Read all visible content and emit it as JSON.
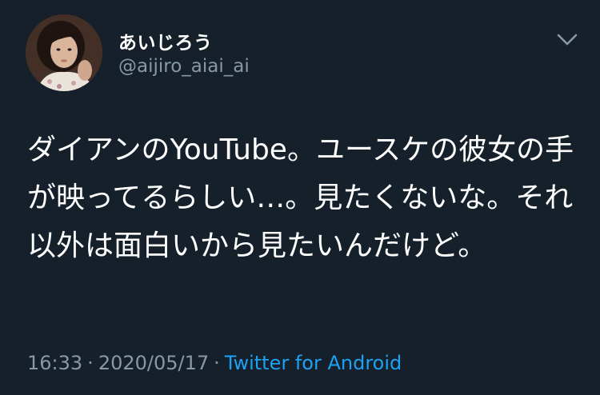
{
  "user": {
    "display_name": "あいじろう",
    "handle": "@aijiro_aiai_ai"
  },
  "icons": {
    "menu": "chevron-down-icon",
    "avatar": "profile-avatar"
  },
  "tweet": {
    "text": "ダイアンのYouTube。ユースケの彼女の手が映ってるらしい…。見たくないな。それ以外は面白いから見たいんだけど。",
    "time": "16:33",
    "date": "2020/05/17",
    "separator": "·",
    "source": "Twitter for Android"
  },
  "colors": {
    "background": "#15202b",
    "text": "#ffffff",
    "secondary": "#8899a6",
    "link": "#1da1f2"
  }
}
